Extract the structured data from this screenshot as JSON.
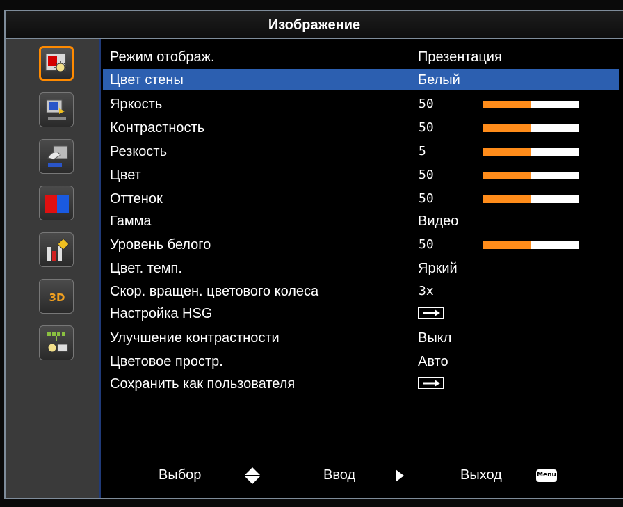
{
  "title": "Изображение",
  "menu": {
    "rows": [
      {
        "label": "Режим отображ.",
        "value": "Презентация"
      },
      {
        "label": "Цвет стены",
        "value": "Белый"
      },
      {
        "label": "Яркость",
        "value": "50",
        "level": 0.5
      },
      {
        "label": "Контрастность",
        "value": "50",
        "level": 0.5
      },
      {
        "label": "Резкость",
        "value": "5",
        "level": 0.5
      },
      {
        "label": "Цвет",
        "value": "50",
        "level": 0.5
      },
      {
        "label": "Оттенок",
        "value": "50",
        "level": 0.5
      },
      {
        "label": "Гамма",
        "value": "Видео"
      },
      {
        "label": "Уровень белого",
        "value": "50",
        "level": 0.5
      },
      {
        "label": "Цвет. темп.",
        "value": "Яркий"
      },
      {
        "label": "Скор. вращен. цветового колеса",
        "value": "3x"
      },
      {
        "label": "Настройка HSG",
        "value_icon": "enter-arrow-icon"
      },
      {
        "label": "Улучшение контрастности",
        "value": "Выкл"
      },
      {
        "label": "Цветовое простр.",
        "value": "Авто"
      },
      {
        "label": "Сохранить как пользователя",
        "value_icon": "enter-arrow-icon"
      }
    ]
  },
  "footer": {
    "select_label": "Выбор",
    "enter_label": "Ввод",
    "exit_label": "Выход",
    "menu_key": "Menu"
  },
  "colors": {
    "accent": "#ff8a00",
    "selection": "#2c5fb0",
    "bar_fill": "#ff8c1a",
    "sidebar": "#3a3a3a"
  },
  "sidebar": {
    "icons": [
      "image-settings-icon",
      "display-settings-icon",
      "setup-icon",
      "color-icon",
      "options-info-icon",
      "3d-icon",
      "network-icon"
    ],
    "active_index": 0
  }
}
